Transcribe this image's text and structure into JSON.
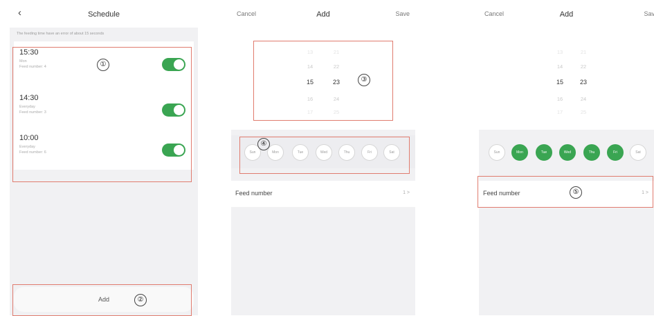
{
  "screen1": {
    "title": "Schedule",
    "back_icon": "chevron-left-icon",
    "notice": "The feeding time have an error of about 15 seconds",
    "schedules": [
      {
        "time": "15:30",
        "repeat": "Mon",
        "feed": "Feed number: 4",
        "enabled": true
      },
      {
        "time": "14:30",
        "repeat": "Everyday",
        "feed": "Feed number: 3",
        "enabled": true
      },
      {
        "time": "10:00",
        "repeat": "Everyday",
        "feed": "Feed number: 6",
        "enabled": true
      }
    ],
    "add_label": "Add",
    "markers": [
      "①",
      "②"
    ]
  },
  "screen2": {
    "cancel": "Cancel",
    "title": "Add",
    "save": "Save",
    "hours": [
      "13",
      "14",
      "15",
      "16",
      "17"
    ],
    "minutes": [
      "21",
      "22",
      "23",
      "24",
      "25"
    ],
    "days": [
      "Sun",
      "Mon",
      "Tue",
      "Wed",
      "Thu",
      "Fri",
      "Sat"
    ],
    "feed_label": "Feed number",
    "feed_value": "1 >",
    "markers": [
      "③",
      "④"
    ]
  },
  "screen3": {
    "cancel": "Cancel",
    "title": "Add",
    "save": "Save",
    "hours": [
      "13",
      "14",
      "15",
      "16",
      "17"
    ],
    "minutes": [
      "21",
      "22",
      "23",
      "24",
      "25"
    ],
    "days": [
      "Sun",
      "Mon",
      "Tue",
      "Wed",
      "Thu",
      "Fri",
      "Sat"
    ],
    "selected_days": [
      false,
      true,
      true,
      true,
      true,
      true,
      false
    ],
    "feed_label": "Feed number",
    "feed_value": "1 >",
    "markers": [
      "⑤"
    ]
  },
  "colors": {
    "accent": "#3aa552",
    "highlight_box": "#e07b6e",
    "background": "#f1f1f3"
  }
}
